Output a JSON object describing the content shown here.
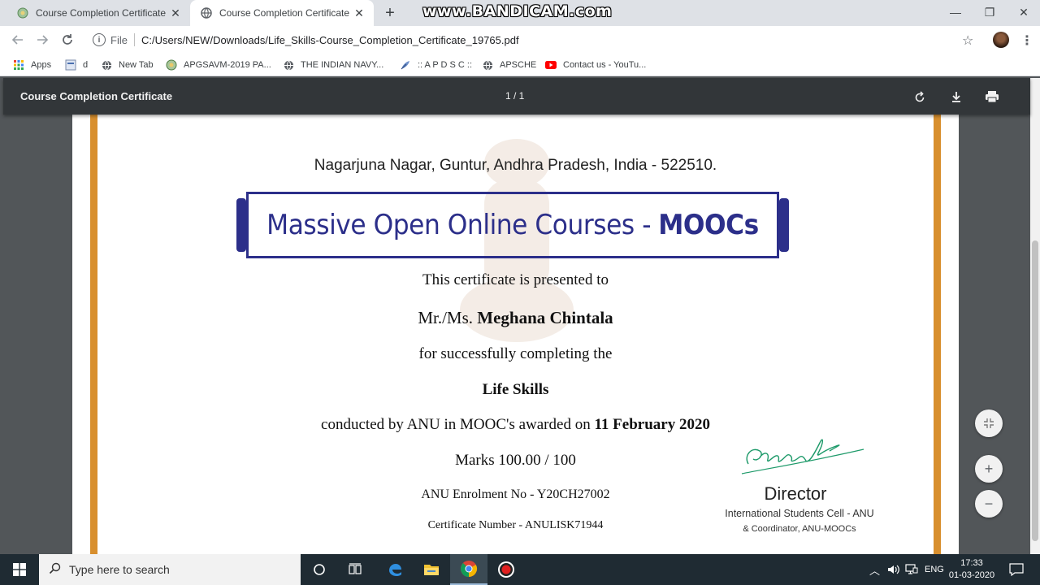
{
  "browser": {
    "tabs": [
      {
        "title": "Course Completion Certificate",
        "active": false
      },
      {
        "title": "Course Completion Certificate",
        "active": true
      }
    ],
    "watermark": "www.BANDICAM.com",
    "address": {
      "scheme": "File",
      "url": "C:/Users/NEW/Downloads/Life_Skills-Course_Completion_Certificate_19765.pdf"
    },
    "bookmarks": [
      {
        "label": "Apps",
        "icon": "apps-grid-icon"
      },
      {
        "label": "d",
        "icon": "page-icon"
      },
      {
        "label": "New Tab",
        "icon": "globe-icon"
      },
      {
        "label": "APGSAVM-2019 PA...",
        "icon": "emblem-icon"
      },
      {
        "label": "THE INDIAN NAVY...",
        "icon": "globe-icon"
      },
      {
        "label": ":: A P D S C ::",
        "icon": "feather-icon"
      },
      {
        "label": "APSCHE",
        "icon": "globe-icon"
      },
      {
        "label": "Contact us - YouTu...",
        "icon": "youtube-icon"
      }
    ]
  },
  "pdf_viewer": {
    "title": "Course Completion Certificate",
    "page_indicator": "1 / 1"
  },
  "certificate": {
    "address": "Nagarjuna Nagar, Guntur,  Andhra Pradesh, India - 522510.",
    "banner_main": "Massive Open Online Courses -",
    "banner_bold": "MOOCs",
    "presented": "This certificate is presented to",
    "name_prefix": "Mr./Ms.",
    "name": "Meghana Chintala",
    "completing": "for successfully completing the",
    "course": "Life Skills",
    "conducted_prefix": "conducted by ANU in MOOC's awarded on",
    "date": "11 February 2020",
    "marks": "Marks 100.00 / 100",
    "enrolment": "ANU Enrolment No - Y20CH27002",
    "certificate_number": "Certificate Number - ANULISK71944",
    "director": "Director",
    "director_line1": "International Students Cell - ANU",
    "director_line2": "& Coordinator, ANU-MOOCs"
  },
  "taskbar": {
    "search_placeholder": "Type here to search",
    "language": "ENG",
    "time": "17:33",
    "date": "01-03-2020"
  },
  "colors": {
    "pdf_toolbar": "#323639",
    "viewer_bg": "#525659",
    "certificate_orange": "#d88f2e",
    "mooc_blue": "#2c2f8a",
    "signature_green": "#1e9a6a",
    "taskbar": "#1f2b33"
  }
}
